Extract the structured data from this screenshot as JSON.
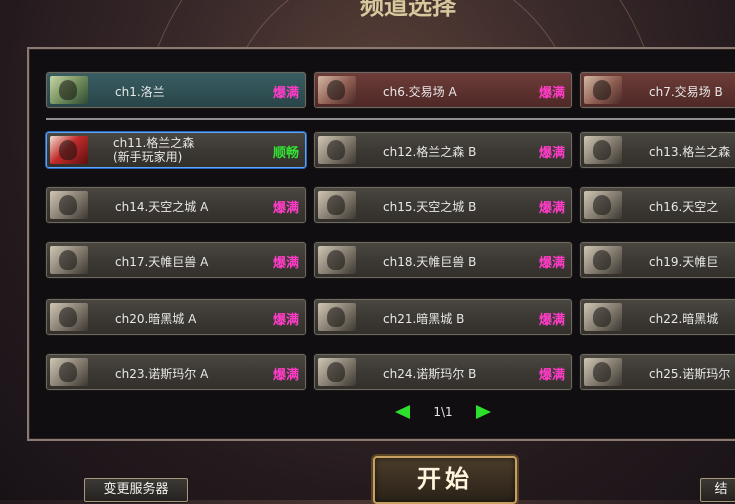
{
  "page_title": "频道选择",
  "strongest_label": "爆满",
  "channels": [
    {
      "name": "ch1.洛兰",
      "status": "爆满",
      "status_color": "#ff3cc8"
    },
    {
      "name": "ch6.交易场 A",
      "status": "爆满",
      "status_color": "#ff3cc8"
    },
    {
      "name": "ch7.交易场 B",
      "status": "",
      "status_color": "#ff3cc8"
    },
    {
      "name": "ch11.格兰之森\n(新手玩家用)",
      "status": "顺畅",
      "status_color": "#33e233"
    },
    {
      "name": "ch12.格兰之森 B",
      "status": "爆满",
      "status_color": "#ff3cc8"
    },
    {
      "name": "ch13.格兰之森",
      "status": "",
      "status_color": "#ff3cc8"
    },
    {
      "name": "ch14.天空之城 A",
      "status": "爆满",
      "status_color": "#ff3cc8"
    },
    {
      "name": "ch15.天空之城 B",
      "status": "爆满",
      "status_color": "#ff3cc8"
    },
    {
      "name": "ch16.天空之",
      "status": "",
      "status_color": "#ff3cc8"
    },
    {
      "name": "ch17.天帷巨兽 A",
      "status": "爆满",
      "status_color": "#ff3cc8"
    },
    {
      "name": "ch18.天帷巨兽 B",
      "status": "爆满",
      "status_color": "#ff3cc8"
    },
    {
      "name": "ch19.天帷巨",
      "status": "",
      "status_color": "#ff3cc8"
    },
    {
      "name": "ch20.暗黑城 A",
      "status": "爆满",
      "status_color": "#ff3cc8"
    },
    {
      "name": "ch21.暗黑城 B",
      "status": "爆满",
      "status_color": "#ff3cc8"
    },
    {
      "name": "ch22.暗黑城",
      "status": "",
      "status_color": "#ff3cc8"
    },
    {
      "name": "ch23.诺斯玛尔 A",
      "status": "爆满",
      "status_color": "#ff3cc8"
    },
    {
      "name": "ch24.诺斯玛尔 B",
      "status": "爆满",
      "status_color": "#ff3cc8"
    },
    {
      "name": "ch25.诺斯玛尔",
      "status": "",
      "status_color": "#ff3cc8"
    }
  ],
  "pager": {
    "text": "1\\1"
  },
  "buttons": {
    "change_server": "变更服务器",
    "start": "开始",
    "right_partial": "结"
  }
}
